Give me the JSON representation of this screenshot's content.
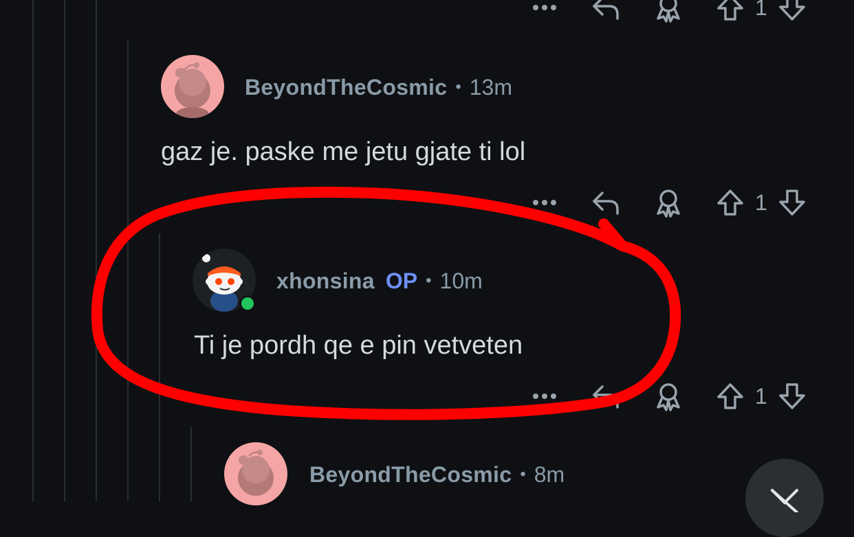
{
  "comments": [
    {
      "author": "BeyondTheCosmic",
      "time": "13m",
      "body": "gaz je. paske me jetu gjate ti lol",
      "score": "1"
    },
    {
      "author": "xhonsina",
      "badge": "OP",
      "time": "10m",
      "body": "Ti je pordh qe e pin vetveten",
      "score": "1",
      "online": true
    },
    {
      "author": "BeyondTheCosmic",
      "time": "8m"
    }
  ],
  "top_action_bar": {
    "score": "1"
  },
  "separator": "•",
  "colors": {
    "background": "#0e1013",
    "meta_text": "#8a9ba8",
    "op_badge": "#6e8ff5",
    "annotation": "#ff0000",
    "online": "#22c55e",
    "avatar_pink": "#f5a5a5"
  },
  "icons": [
    "more-icon",
    "reply-icon",
    "award-icon",
    "upvote-icon",
    "downvote-icon",
    "collapse-icon"
  ]
}
